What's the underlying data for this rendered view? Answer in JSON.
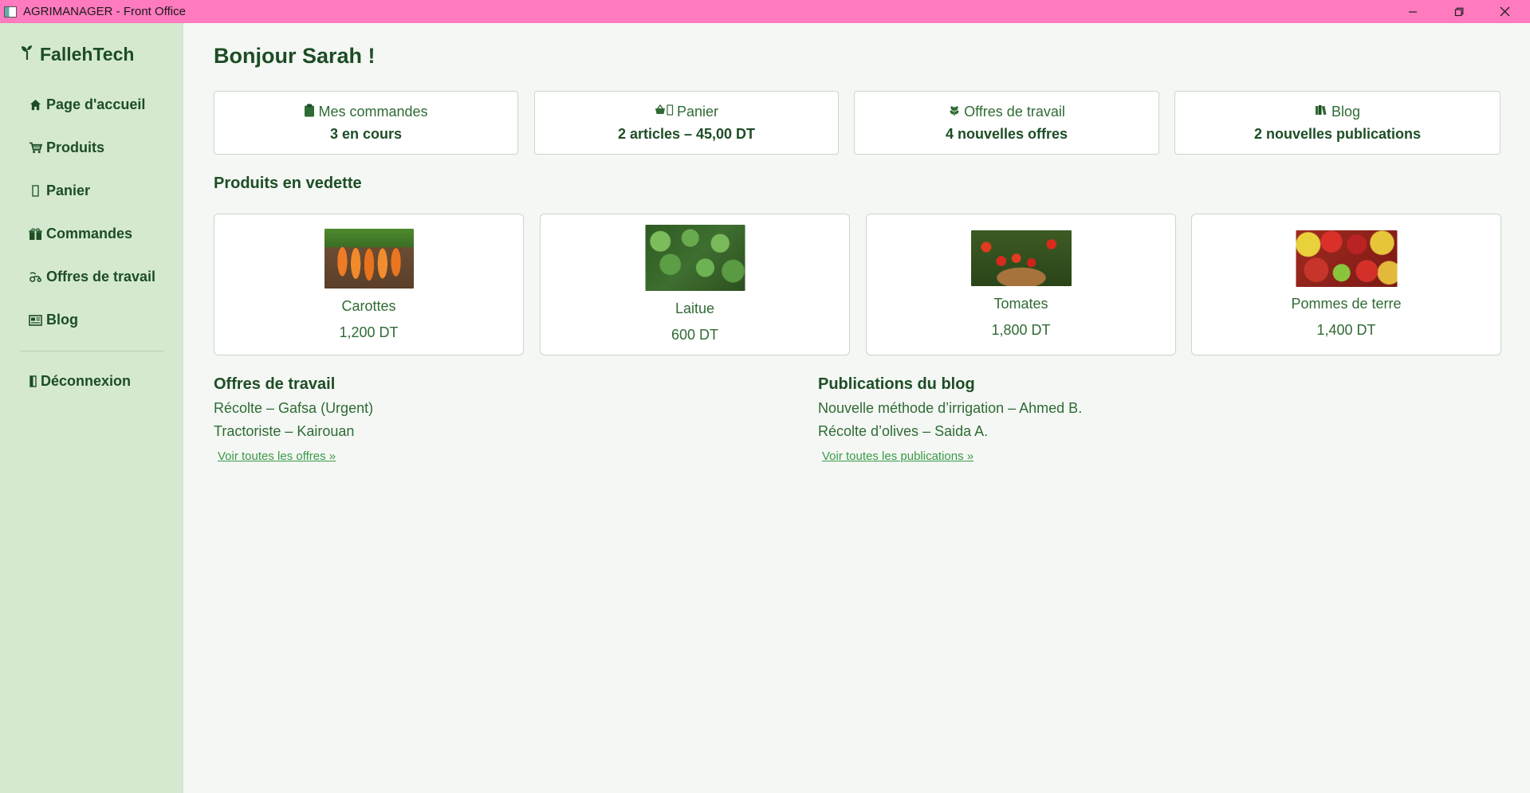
{
  "window": {
    "title": "AGRIMANAGER - Front Office",
    "app_icon": "window-app-icon",
    "controls": [
      "minimize-icon",
      "restore-icon",
      "close-icon"
    ]
  },
  "sidebar": {
    "brand": "FallehTech",
    "brand_icon": "sprout-icon",
    "items": [
      {
        "label": "Page d'accueil",
        "icon": "home-icon",
        "glyph": "🏠"
      },
      {
        "label": "Produits",
        "icon": "cart-icon",
        "glyph": "🛒"
      },
      {
        "label": "Panier",
        "icon": "basket-icon",
        "glyph": "▯"
      },
      {
        "label": "Commandes",
        "icon": "package-icon",
        "glyph": "🎁"
      },
      {
        "label": "Offres de travail",
        "icon": "tractor-icon",
        "glyph": "🚜"
      },
      {
        "label": "Blog",
        "icon": "newspaper-icon",
        "glyph": "📰"
      }
    ],
    "logout": {
      "label": "Déconnexion",
      "icon": "door-icon",
      "glyph": "🚪"
    }
  },
  "main": {
    "greeting": "Bonjour Sarah !",
    "stats": [
      {
        "label": "Mes commandes",
        "value": "3 en cours",
        "icon": "clipboard-icon",
        "glyph": "📋"
      },
      {
        "label": "Panier",
        "value": "2 articles – 45,00 DT",
        "icon": "basket-icon",
        "glyph": "🧺▯"
      },
      {
        "label": "Offres de travail",
        "value": "4 nouvelles offres",
        "icon": "wheat-icon",
        "glyph": "🌾"
      },
      {
        "label": "Blog",
        "value": "2 nouvelles publications",
        "icon": "books-icon",
        "glyph": "📚"
      }
    ],
    "featured_title": "Produits en vedette",
    "products": [
      {
        "name": "Carottes",
        "price": "1,200 DT"
      },
      {
        "name": "Laitue",
        "price": "600 DT"
      },
      {
        "name": "Tomates",
        "price": "1,800 DT"
      },
      {
        "name": "Pommes de terre",
        "price": "1,400 DT"
      }
    ],
    "jobs": {
      "title": "Offres de travail",
      "items": [
        "Récolte – Gafsa (Urgent)",
        "Tractoriste – Kairouan"
      ],
      "link": "Voir toutes les offres »"
    },
    "blog": {
      "title": "Publications du blog",
      "items": [
        "Nouvelle méthode d’irrigation – Ahmed B.",
        "Récolte d’olives – Saida A."
      ],
      "link": "Voir toutes les publications »"
    }
  },
  "colors": {
    "titlebar": "#ff7abf",
    "sidebar_bg": "#d4e9d0",
    "page_bg": "#f4f7f4",
    "text_dark_green": "#1d4d25",
    "text_green": "#2f6b34",
    "link_green": "#3a9a48"
  }
}
